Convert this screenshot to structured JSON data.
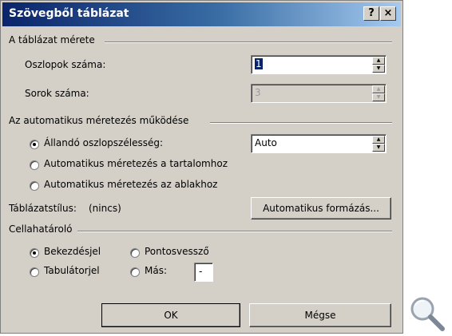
{
  "dialog": {
    "title": "Szövegből táblázat",
    "help_label": "?",
    "close_label": "×"
  },
  "size_group": {
    "label": "A táblázat mérete",
    "columns_label": "Oszlopok száma:",
    "columns_value": "1",
    "rows_label": "Sorok száma:",
    "rows_value": "3"
  },
  "autofit_group": {
    "label": "Az automatikus méretezés működése",
    "fixed_label": "Állandó oszlopszélesség:",
    "fixed_value": "Auto",
    "content_label": "Automatikus méretezés a tartalomhoz",
    "window_label": "Automatikus méretezés az ablakhoz"
  },
  "style": {
    "label": "Táblázatstílus:",
    "value": "(nincs)",
    "autoformat_label": "Automatikus formázás..."
  },
  "separator_group": {
    "label": "Cellahatároló",
    "paragraph_label": "Bekezdésjel",
    "semicolon_label": "Pontosvessző",
    "tab_label": "Tabulátorjel",
    "other_label": "Más:",
    "other_value": "-"
  },
  "buttons": {
    "ok_label": "OK",
    "cancel_label": "Mégse"
  },
  "icons": {
    "zoom": "magnifier-icon"
  }
}
